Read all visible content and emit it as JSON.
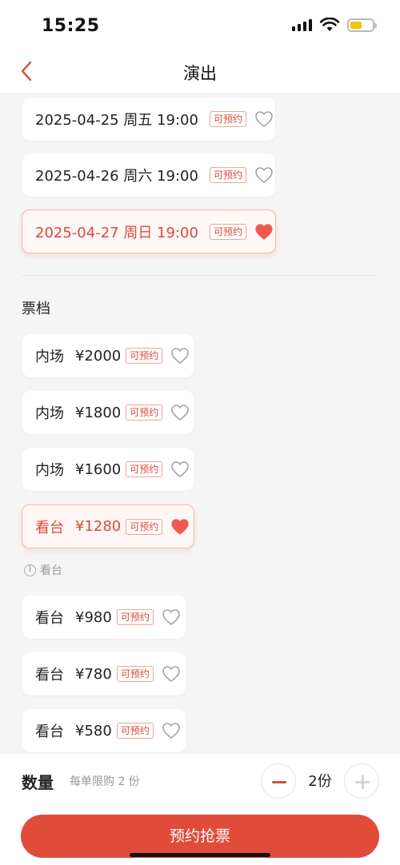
{
  "status_bar": {
    "time": "15:25"
  },
  "nav": {
    "title": "演出"
  },
  "badge_label": "可预约",
  "dates": [
    {
      "label": "2025-04-25 周五 19:00",
      "favorited": false
    },
    {
      "label": "2025-04-26 周六 19:00",
      "favorited": false
    },
    {
      "label": "2025-04-27 周日 19:00",
      "favorited": true,
      "selected": true
    }
  ],
  "ticket_section": {
    "title": "票档",
    "note": "看台",
    "tiers": [
      {
        "area": "内场",
        "price": "¥2000",
        "favorited": false
      },
      {
        "area": "内场",
        "price": "¥1800",
        "favorited": false
      },
      {
        "area": "内场",
        "price": "¥1600",
        "favorited": false
      },
      {
        "area": "看台",
        "price": "¥1280",
        "favorited": true,
        "selected": true
      },
      {
        "area": "看台",
        "price": "¥980",
        "favorited": false
      },
      {
        "area": "看台",
        "price": "¥780",
        "favorited": false
      },
      {
        "area": "看台",
        "price": "¥580",
        "favorited": false
      }
    ]
  },
  "quantity": {
    "label": "数量",
    "limit_text": "每单限购 2 份",
    "value": "2份"
  },
  "submit": {
    "label": "预约抢票"
  },
  "colors": {
    "accent": "#e04b3a",
    "selected_bg": "#fff7f5",
    "heart_fill": "#ef5a4c"
  }
}
